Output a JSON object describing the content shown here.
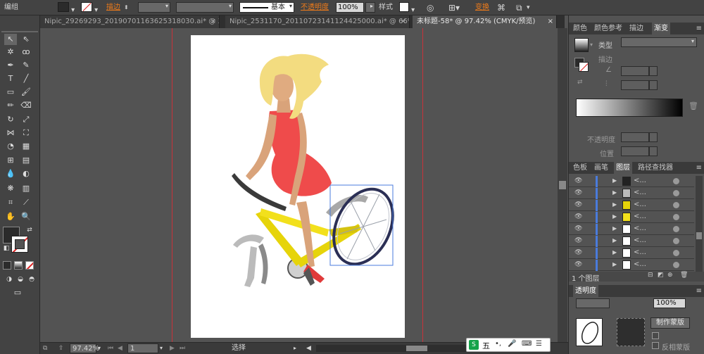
{
  "control_bar": {
    "object_type": "编组",
    "stroke_label": "描边",
    "stroke_weight": "",
    "stroke_profile": "基本",
    "opacity_label": "不透明度",
    "opacity_value": "100%",
    "style_label": "样式",
    "transform_label": "变换"
  },
  "tabs": [
    {
      "label": "Nipic_29269293_20190701163625318030.ai* @ 33...",
      "close": "×"
    },
    {
      "label": "Nipic_2531170_20110723141124425000.ai* @ 66%...",
      "close": "×"
    },
    {
      "label": "未标题-58* @ 97.42% (CMYK/预览)",
      "close": "×"
    }
  ],
  "status_bar": {
    "zoom": "97.42%",
    "page": "1",
    "tool_name": "选择"
  },
  "gradient_panel": {
    "tabs": [
      "颜色",
      "颜色参考",
      "描边",
      "渐变"
    ],
    "active_tab": "渐变",
    "type_label": "类型",
    "stroke_label": "描边",
    "opacity_label": "不透明度",
    "position_label": "位置"
  },
  "layers_panel": {
    "tabs": [
      "色板",
      "画笔",
      "图层",
      "路径查找器"
    ],
    "active_tab": "图层",
    "rows": [
      "<...",
      "<...",
      "<...",
      "<...",
      "<...",
      "<...",
      "<...",
      "<..."
    ],
    "footer": "1 个图层"
  },
  "transparency_panel": {
    "title": "透明度",
    "opacity_value": "100%",
    "make_mask_button": "制作蒙版",
    "invert_mask_label": "反相蒙版"
  },
  "ime": {
    "label": "五"
  },
  "colors": {
    "ui_dark": "#434343",
    "canvas": "#535353",
    "accent_orange": "#ee7b1a",
    "guide_red": "#c8323a",
    "selection_blue": "#4a7bdc"
  }
}
